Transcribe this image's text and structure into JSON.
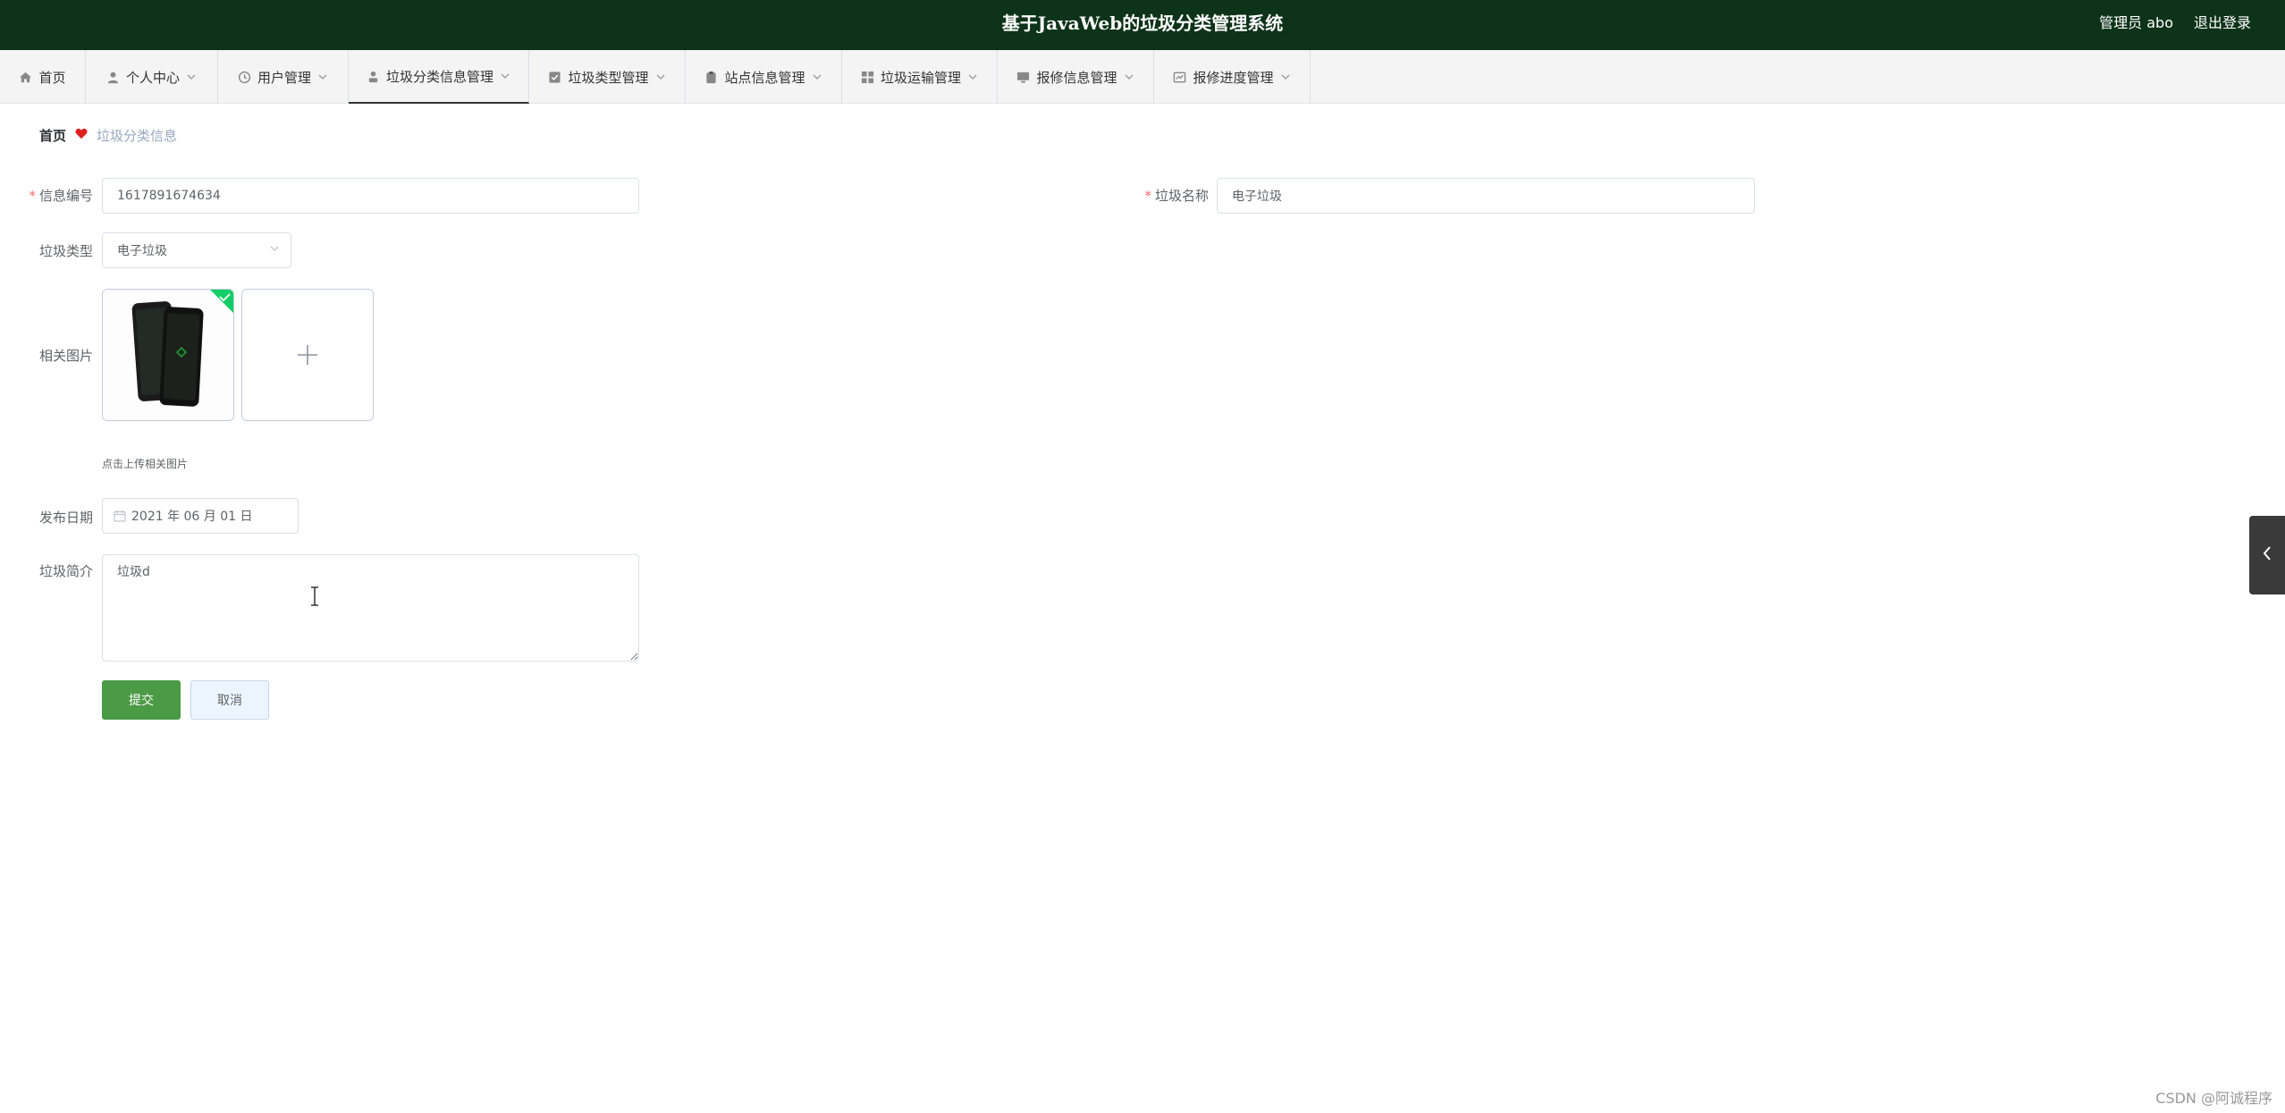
{
  "header": {
    "title": "基于JavaWeb的垃圾分类管理系统",
    "user": "管理员 abo",
    "logout": "退出登录"
  },
  "nav": {
    "items": [
      {
        "label": "首页",
        "icon": "home-icon",
        "has_dropdown": false
      },
      {
        "label": "个人中心",
        "icon": "user-icon",
        "has_dropdown": true
      },
      {
        "label": "用户管理",
        "icon": "clock-icon",
        "has_dropdown": true
      },
      {
        "label": "垃圾分类信息管理",
        "icon": "person-icon",
        "has_dropdown": true,
        "active": true
      },
      {
        "label": "垃圾类型管理",
        "icon": "checkbox-icon",
        "has_dropdown": true
      },
      {
        "label": "站点信息管理",
        "icon": "clipboard-icon",
        "has_dropdown": true
      },
      {
        "label": "垃圾运输管理",
        "icon": "grid-icon",
        "has_dropdown": true
      },
      {
        "label": "报修信息管理",
        "icon": "monitor-icon",
        "has_dropdown": true
      },
      {
        "label": "报修进度管理",
        "icon": "chart-icon",
        "has_dropdown": true
      }
    ]
  },
  "breadcrumb": {
    "home": "首页",
    "current": "垃圾分类信息"
  },
  "form": {
    "info_no_label": "信息编号",
    "info_no_value": "1617891674634",
    "name_label": "垃圾名称",
    "name_value": "电子垃圾",
    "type_label": "垃圾类型",
    "type_value": "电子垃圾",
    "image_label": "相关图片",
    "image_tip": "点击上传相关图片",
    "date_label": "发布日期",
    "date_value": "2021 年 06 月 01 日",
    "intro_label": "垃圾简介",
    "intro_value": "垃圾d",
    "submit": "提交",
    "cancel": "取消"
  },
  "watermark": "CSDN @阿诚程序",
  "colors": {
    "header_bg": "#0d3318",
    "primary": "#4a9a46",
    "required": "#f56c6c",
    "upload_success": "#13ce66"
  }
}
